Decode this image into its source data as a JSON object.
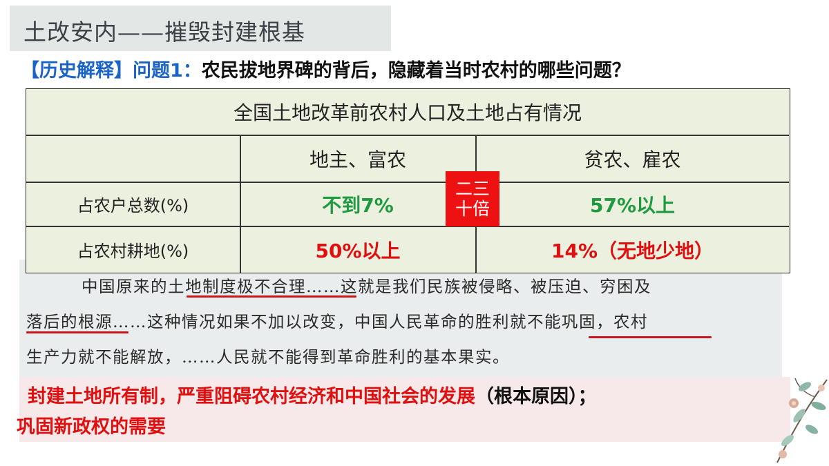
{
  "slide": {
    "title": "土改安内——摧毁封建根基",
    "question_tag": "【历史解释】问题1：",
    "question_text": "农民拔地界碑的背后，隐藏着当时农村的哪些问题？"
  },
  "table": {
    "caption": "全国土地改革前农村人口及土地占有情况",
    "columns": [
      "地主、富农",
      "贫农、雇农"
    ],
    "rows": [
      {
        "label": "占农户总数(%)",
        "values": [
          "不到7%",
          "57%以上"
        ]
      },
      {
        "label": "占农村耕地(%)",
        "values": [
          "50%以上",
          "14%（无地少地）"
        ]
      }
    ],
    "ratio_box": {
      "line1": "二三",
      "line2": "十倍"
    }
  },
  "quote": {
    "lines": [
      "中国原来的土地制度极不合理……这就是我们民族被侵略、被压迫、穷困及",
      "落后的根源……这种情况如果不加以改变，中国人民革命的胜利就不能巩固，农村",
      "生产力就不能解放，……人民就不能得到革命胜利的基本果实。"
    ]
  },
  "conclusion": {
    "part1": "封建土地所有制，严重阻碍农村经济和中国社会的发展",
    "part2": "（根本原因）；",
    "part3": "巩固新政权的需要"
  },
  "colors": {
    "accent_blue": "#1a64c8",
    "red": "#e01010",
    "green": "#1e9a40",
    "table_bg": "#ecf0de",
    "ratio_box": "#ee1111"
  },
  "icons": {
    "decoration": "floral-branch-icon"
  }
}
